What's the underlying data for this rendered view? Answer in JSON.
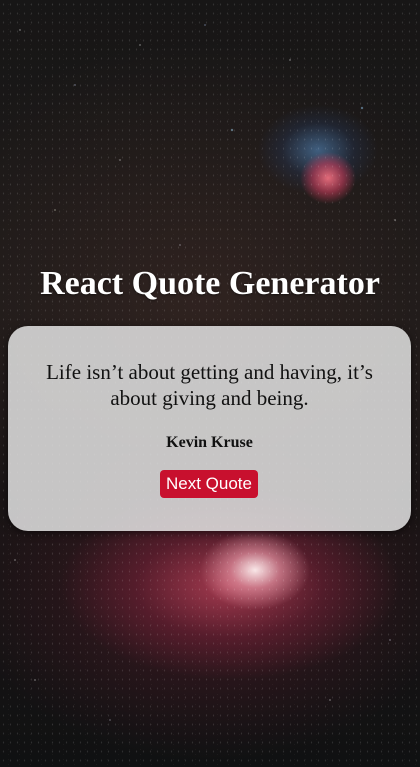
{
  "app": {
    "title": "React Quote Generator"
  },
  "quote": {
    "text": "Life isn’t about getting and having, it’s about giving and being.",
    "author": "Kevin Kruse"
  },
  "actions": {
    "next_label": "Next Quote"
  },
  "colors": {
    "button": "#c8102e",
    "card": "#e2e2e2",
    "title": "#ffffff"
  }
}
